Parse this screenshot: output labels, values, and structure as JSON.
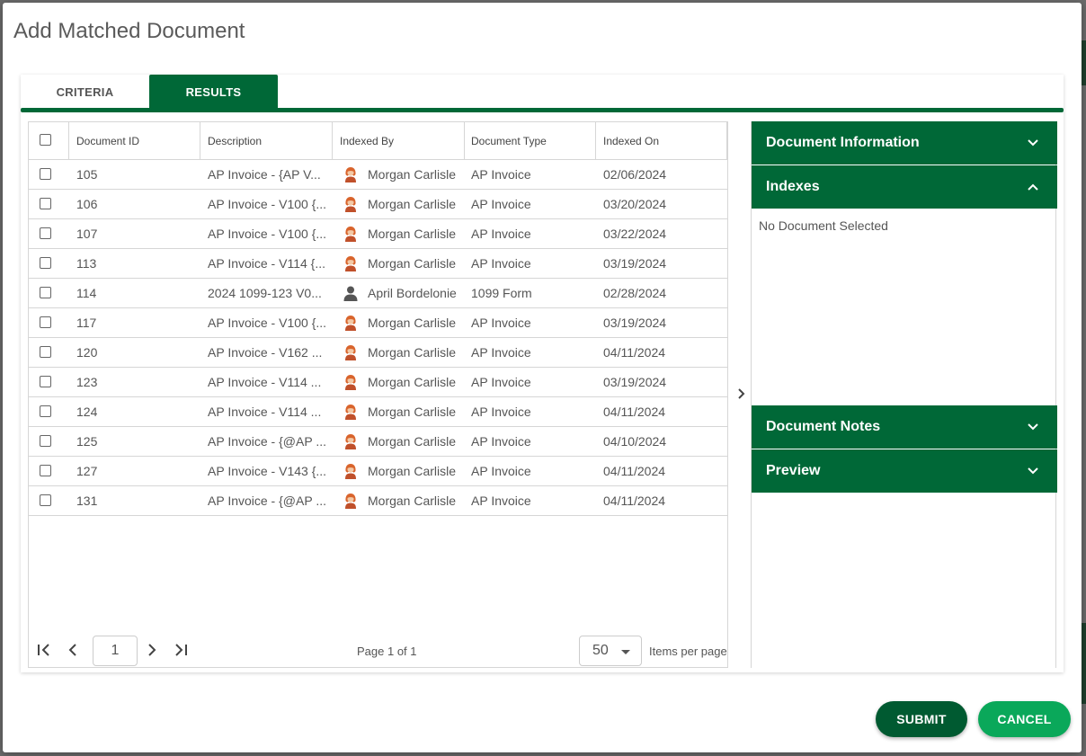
{
  "dialog": {
    "title": "Add Matched Document"
  },
  "tabs": [
    {
      "label": "CRITERIA",
      "active": false
    },
    {
      "label": "RESULTS",
      "active": true
    }
  ],
  "grid": {
    "columns": [
      "Document ID",
      "Description",
      "Indexed By",
      "Document Type",
      "Indexed On"
    ],
    "rows": [
      {
        "id": "105",
        "description": "AP Invoice - {AP V...",
        "indexed_by": "Morgan Carlisle",
        "avatar": "woman-avatar-icon",
        "type": "AP Invoice",
        "indexed_on": "02/06/2024"
      },
      {
        "id": "106",
        "description": "AP Invoice - V100 {...",
        "indexed_by": "Morgan Carlisle",
        "avatar": "woman-avatar-icon",
        "type": "AP Invoice",
        "indexed_on": "03/20/2024"
      },
      {
        "id": "107",
        "description": "AP Invoice - V100 {...",
        "indexed_by": "Morgan Carlisle",
        "avatar": "woman-avatar-icon",
        "type": "AP Invoice",
        "indexed_on": "03/22/2024"
      },
      {
        "id": "113",
        "description": "AP Invoice - V114 {...",
        "indexed_by": "Morgan Carlisle",
        "avatar": "woman-avatar-icon",
        "type": "AP Invoice",
        "indexed_on": "03/19/2024"
      },
      {
        "id": "114",
        "description": "2024 1099-123 V0...",
        "indexed_by": "April Bordelonie",
        "avatar": "generic-user-icon",
        "type": "1099 Form",
        "indexed_on": "02/28/2024"
      },
      {
        "id": "117",
        "description": "AP Invoice - V100 {...",
        "indexed_by": "Morgan Carlisle",
        "avatar": "woman-avatar-icon",
        "type": "AP Invoice",
        "indexed_on": "03/19/2024"
      },
      {
        "id": "120",
        "description": "AP Invoice - V162 ...",
        "indexed_by": "Morgan Carlisle",
        "avatar": "woman-avatar-icon",
        "type": "AP Invoice",
        "indexed_on": "04/11/2024"
      },
      {
        "id": "123",
        "description": "AP Invoice - V114 ...",
        "indexed_by": "Morgan Carlisle",
        "avatar": "woman-avatar-icon",
        "type": "AP Invoice",
        "indexed_on": "03/19/2024"
      },
      {
        "id": "124",
        "description": "AP Invoice - V114 ...",
        "indexed_by": "Morgan Carlisle",
        "avatar": "woman-avatar-icon",
        "type": "AP Invoice",
        "indexed_on": "04/11/2024"
      },
      {
        "id": "125",
        "description": "AP Invoice - {@AP ...",
        "indexed_by": "Morgan Carlisle",
        "avatar": "woman-avatar-icon",
        "type": "AP Invoice",
        "indexed_on": "04/10/2024"
      },
      {
        "id": "127",
        "description": "AP Invoice - V143 {...",
        "indexed_by": "Morgan Carlisle",
        "avatar": "woman-avatar-icon",
        "type": "AP Invoice",
        "indexed_on": "04/11/2024"
      },
      {
        "id": "131",
        "description": "AP Invoice - {@AP ...",
        "indexed_by": "Morgan Carlisle",
        "avatar": "woman-avatar-icon",
        "type": "AP Invoice",
        "indexed_on": "04/11/2024"
      }
    ]
  },
  "pager": {
    "current_page": "1",
    "info": "Page 1 of 1",
    "page_size": "50",
    "page_size_label": "Items per page"
  },
  "side_panel": {
    "sections": [
      "Document Information",
      "Indexes",
      "Document Notes",
      "Preview"
    ],
    "empty_text": "No Document Selected"
  },
  "actions": {
    "submit": "SUBMIT",
    "cancel": "CANCEL"
  },
  "colors": {
    "primary": "#006837",
    "submit": "#005a31",
    "cancel": "#0aa85a"
  }
}
